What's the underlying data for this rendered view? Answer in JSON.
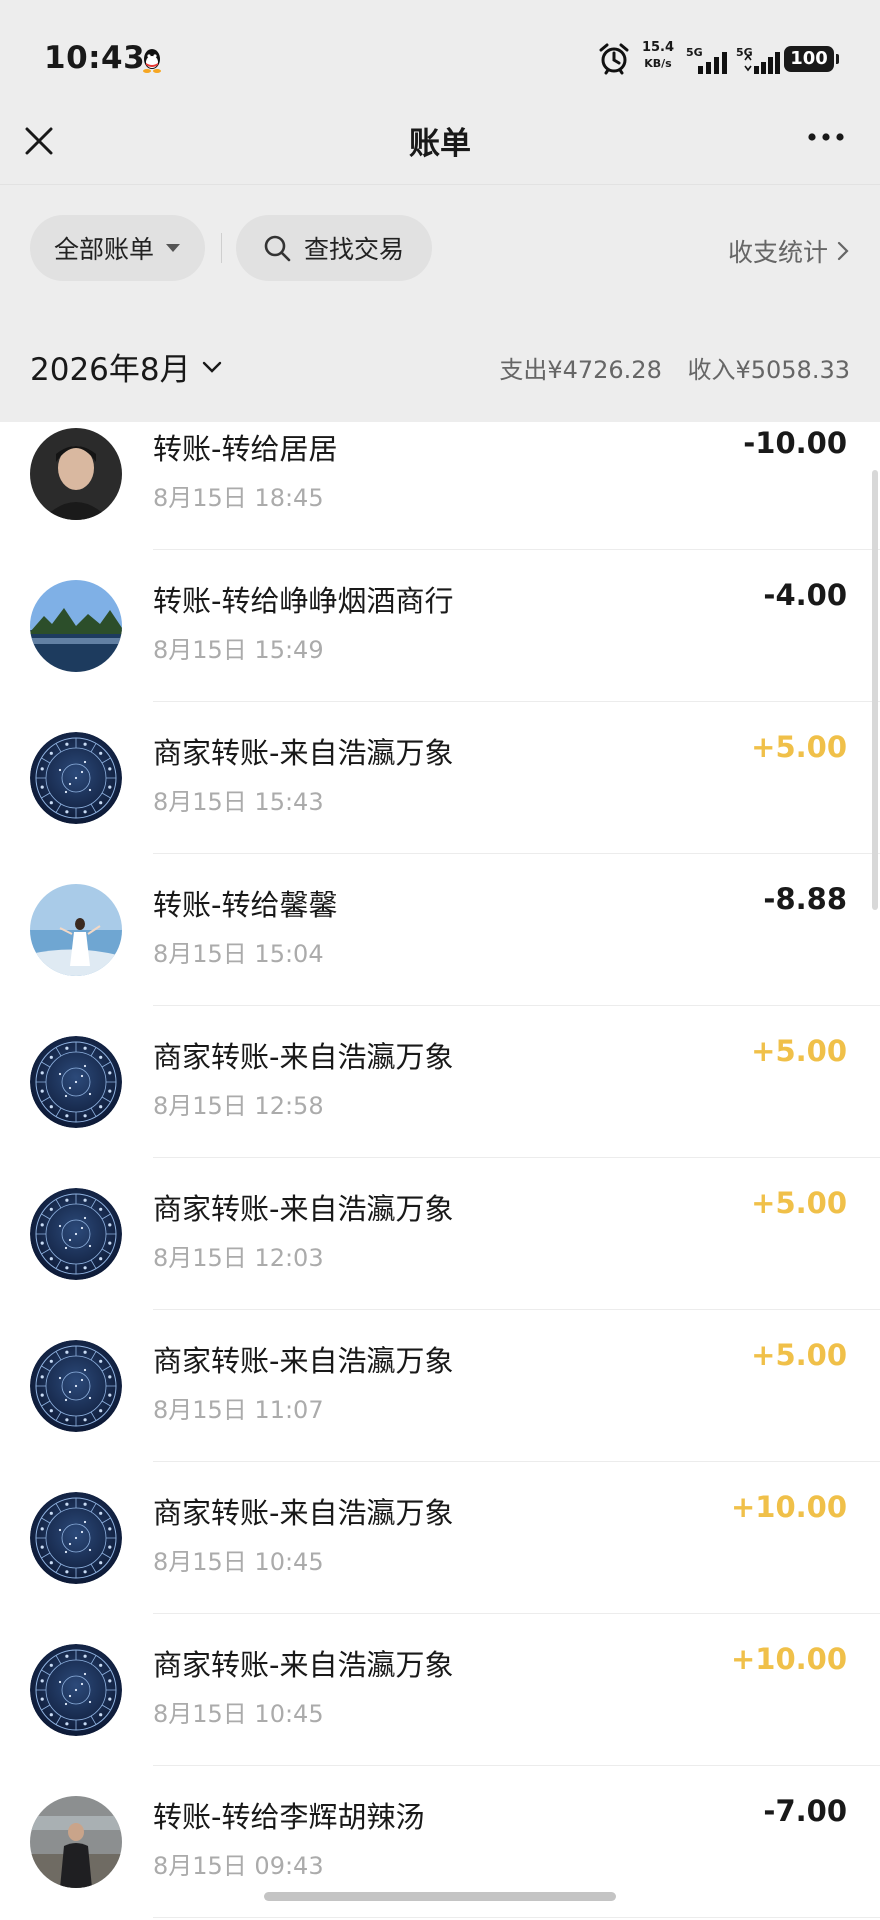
{
  "status_bar": {
    "time": "10:43",
    "net_speed": "15.4",
    "net_unit": "KB/s",
    "sim1_label": "5G",
    "sim2_label": "5G",
    "battery": "100",
    "icons": [
      "qq-icon",
      "alarm-icon",
      "signal-icon",
      "battery-icon"
    ]
  },
  "nav": {
    "title": "账单",
    "close_icon": "close-icon",
    "more_icon": "more-icon"
  },
  "filters": {
    "all_bills": "全部账单",
    "search": "查找交易",
    "stats": "收支统计"
  },
  "month": {
    "label": "2026年8月",
    "expense": "支出¥4726.28",
    "income": "收入¥5058.33"
  },
  "colors": {
    "income": "#f0c049",
    "expense": "#191919",
    "background": "#ededed"
  },
  "transactions": [
    {
      "title": "转账-转给居居",
      "time": "8月15日 18:45",
      "amount": "-10.00",
      "type": "out",
      "avatar": "portrait-avatar"
    },
    {
      "title": "转账-转给峥峥烟酒商行",
      "time": "8月15日 15:49",
      "amount": "-4.00",
      "type": "out",
      "avatar": "landscape-avatar"
    },
    {
      "title": "商家转账-来自浩瀛万象",
      "time": "8月15日 15:43",
      "amount": "+5.00",
      "type": "in",
      "avatar": "zodiac-avatar"
    },
    {
      "title": "转账-转给馨馨",
      "time": "8月15日 15:04",
      "amount": "-8.88",
      "type": "out",
      "avatar": "beach-avatar"
    },
    {
      "title": "商家转账-来自浩瀛万象",
      "time": "8月15日 12:58",
      "amount": "+5.00",
      "type": "in",
      "avatar": "zodiac-avatar"
    },
    {
      "title": "商家转账-来自浩瀛万象",
      "time": "8月15日 12:03",
      "amount": "+5.00",
      "type": "in",
      "avatar": "zodiac-avatar"
    },
    {
      "title": "商家转账-来自浩瀛万象",
      "time": "8月15日 11:07",
      "amount": "+5.00",
      "type": "in",
      "avatar": "zodiac-avatar"
    },
    {
      "title": "商家转账-来自浩瀛万象",
      "time": "8月15日 10:45",
      "amount": "+10.00",
      "type": "in",
      "avatar": "zodiac-avatar"
    },
    {
      "title": "商家转账-来自浩瀛万象",
      "time": "8月15日 10:45",
      "amount": "+10.00",
      "type": "in",
      "avatar": "zodiac-avatar"
    },
    {
      "title": "转账-转给李辉胡辣汤",
      "time": "8月15日 09:43",
      "amount": "-7.00",
      "type": "out",
      "avatar": "person-outdoor-avatar"
    }
  ]
}
